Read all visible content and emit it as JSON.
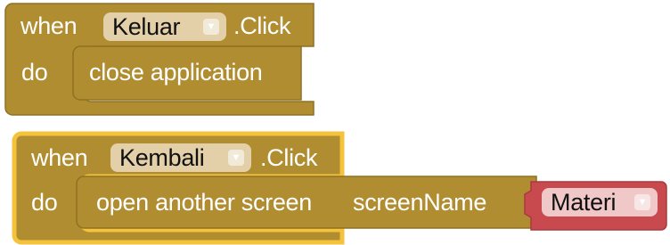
{
  "colors": {
    "event_block": "#b08d30",
    "event_block_dark": "#8f7124",
    "selected_outline": "#f5c23b",
    "text_block": "#b08d30",
    "red_block": "#c8494e",
    "dropdown_bg": "#e3d0a8"
  },
  "blocks": [
    {
      "when_label": "when",
      "component": "Keluar",
      "event": ".Click",
      "do_label": "do",
      "statement": "close application",
      "selected": false
    },
    {
      "when_label": "when",
      "component": "Kembali",
      "event": ".Click",
      "do_label": "do",
      "statement": "open another screen",
      "param_label": "screenName",
      "value_block": "Materi",
      "selected": true
    }
  ],
  "icons": {
    "dropdown_arrow": "triangle-down"
  }
}
